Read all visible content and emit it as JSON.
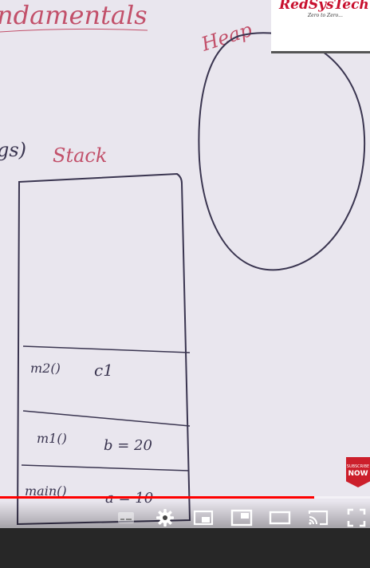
{
  "whiteboard": {
    "title_partial": "ndamentals",
    "args_partial": "gs)",
    "stack_label": "Stack",
    "heap_label": "Heap",
    "frames": [
      {
        "method": "m2()",
        "vars": "c1"
      },
      {
        "method": "m1()",
        "vars": "b = 20"
      },
      {
        "method": "main()",
        "vars": "a = 10"
      }
    ]
  },
  "channel_logo": {
    "brand": "RedSysTech",
    "tagline": "Zero to Zero..."
  },
  "subscribe_badge": {
    "small_text": "SUBSCRIBE",
    "big_text": "NOW",
    "color": "#cc1f2b"
  },
  "player": {
    "progress_fraction": 0.85,
    "progress_color": "#ff0000",
    "controls": [
      {
        "name": "subtitles-icon"
      },
      {
        "name": "settings-gear-icon"
      },
      {
        "name": "miniplayer-icon"
      },
      {
        "name": "picture-in-picture-icon"
      },
      {
        "name": "theater-mode-icon"
      },
      {
        "name": "cast-icon"
      },
      {
        "name": "fullscreen-icon"
      }
    ]
  }
}
